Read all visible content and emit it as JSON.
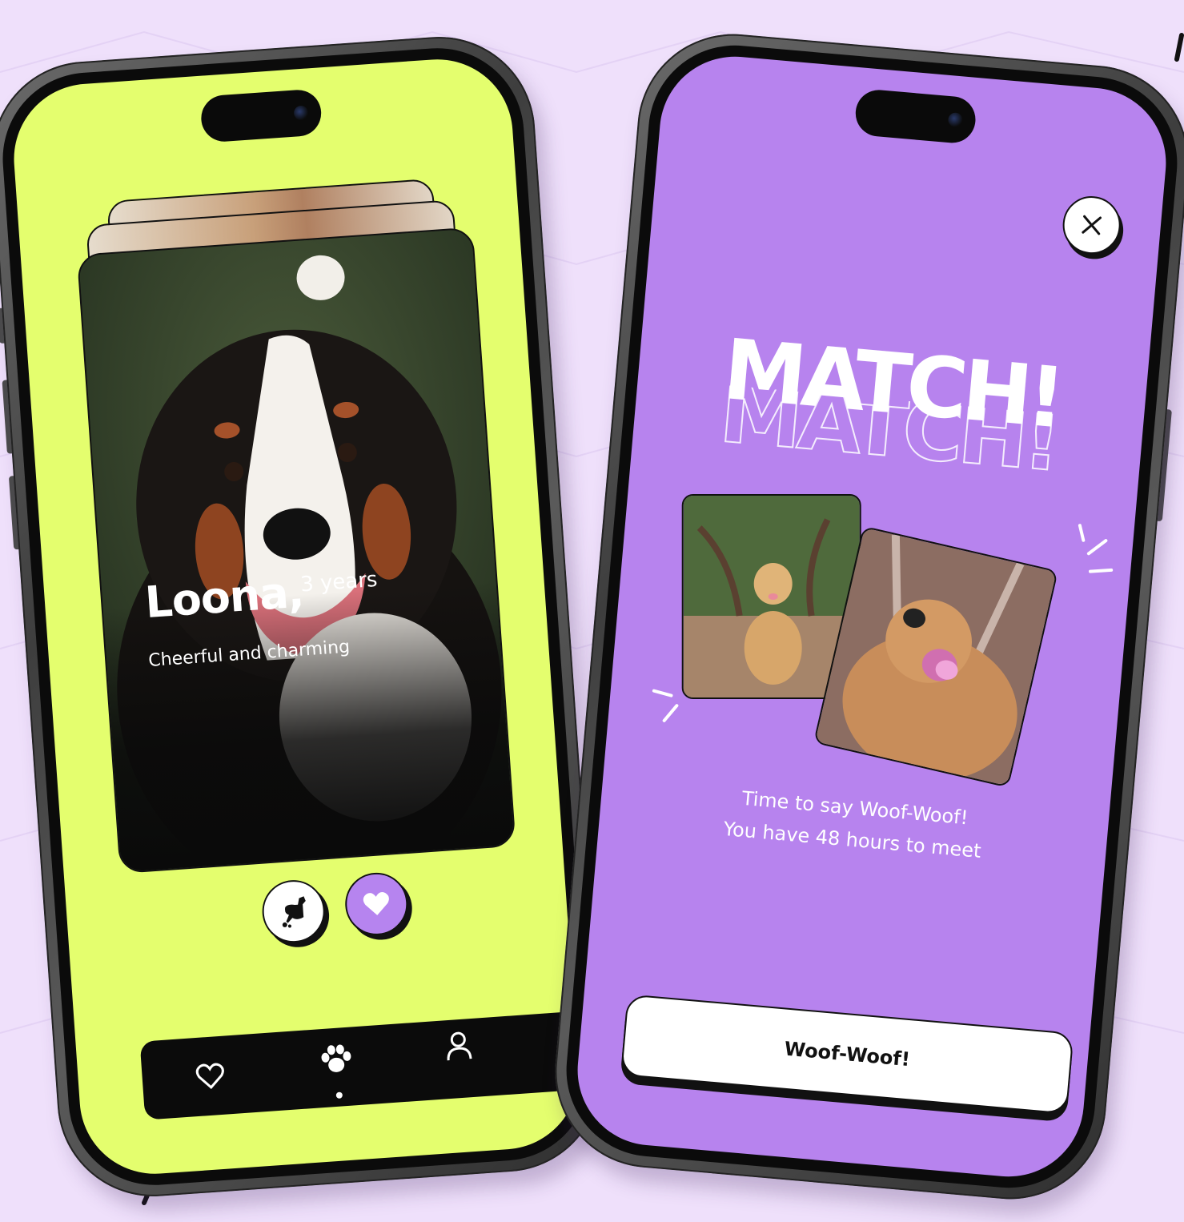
{
  "left_screen": {
    "profile": {
      "name": "Loona,",
      "age": "3 years",
      "description": "Cheerful and charming"
    },
    "actions": {
      "nope_icon": "pooping-dog-icon",
      "like_icon": "heart-icon"
    },
    "tabbar": {
      "items": [
        {
          "icon": "heart-outline-icon"
        },
        {
          "icon": "paw-icon",
          "active": true
        },
        {
          "icon": "person-icon"
        }
      ]
    },
    "colors": {
      "background": "#e4fe6e",
      "accent": "#b684ef",
      "dark": "#0b0b0b"
    }
  },
  "right_screen": {
    "close_icon": "close-icon",
    "title": "MATCH!",
    "message_line1": "Time to say Woof-Woof!",
    "message_line2": "You have 48 hours to meet",
    "cta_label": "Woof-Woof!",
    "colors": {
      "background": "#b783ee",
      "button": "#ffffff"
    }
  },
  "page": {
    "background": "#efe0fb"
  }
}
